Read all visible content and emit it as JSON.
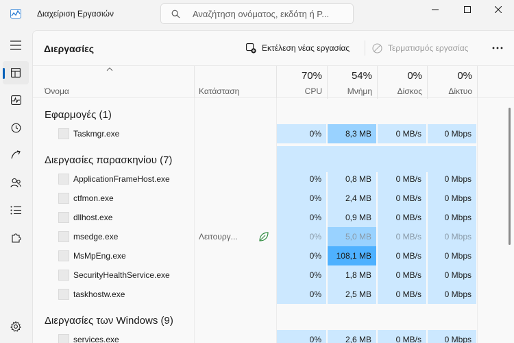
{
  "window": {
    "title": "Διαχείριση Εργασιών",
    "search_placeholder": "Αναζήτηση ονόματος, εκδότη ή P..."
  },
  "toolbar": {
    "page_title": "Διεργασίες",
    "run_new_task": "Εκτέλεση νέας εργασίας",
    "end_task": "Τερματισμός εργασίας"
  },
  "columns": {
    "name": "Όνομα",
    "status": "Κατάσταση",
    "cpu": {
      "percent": "70%",
      "label": "CPU"
    },
    "memory": {
      "percent": "54%",
      "label": "Μνήμη"
    },
    "disk": {
      "percent": "0%",
      "label": "Δίσκος"
    },
    "network": {
      "percent": "0%",
      "label": "Δίκτυο"
    }
  },
  "groups": {
    "apps": {
      "label": "Εφαρμογές (1)",
      "rows": [
        {
          "name": "Taskmgr.exe",
          "status": "",
          "cpu": "0%",
          "memory": "8,3 MB",
          "disk": "0 MB/s",
          "network": "0 Mbps"
        }
      ]
    },
    "background": {
      "label": "Διεργασίες παρασκηνίου (7)",
      "rows": [
        {
          "name": "ApplicationFrameHost.exe",
          "status": "",
          "cpu": "0%",
          "memory": "0,8 MB",
          "disk": "0 MB/s",
          "network": "0 Mbps"
        },
        {
          "name": "ctfmon.exe",
          "status": "",
          "cpu": "0%",
          "memory": "2,4 MB",
          "disk": "0 MB/s",
          "network": "0 Mbps"
        },
        {
          "name": "dllhost.exe",
          "status": "",
          "cpu": "0%",
          "memory": "0,9 MB",
          "disk": "0 MB/s",
          "network": "0 Mbps"
        },
        {
          "name": "msedge.exe",
          "status": "Λειτουργ...",
          "cpu": "0%",
          "memory": "5,0 MB",
          "disk": "0 MB/s",
          "network": "0 Mbps"
        },
        {
          "name": "MsMpEng.exe",
          "status": "",
          "cpu": "0%",
          "memory": "108,1 MB",
          "disk": "0 MB/s",
          "network": "0 Mbps"
        },
        {
          "name": "SecurityHealthService.exe",
          "status": "",
          "cpu": "0%",
          "memory": "1,8 MB",
          "disk": "0 MB/s",
          "network": "0 Mbps"
        },
        {
          "name": "taskhostw.exe",
          "status": "",
          "cpu": "0%",
          "memory": "2,5 MB",
          "disk": "0 MB/s",
          "network": "0 Mbps"
        }
      ]
    },
    "windows": {
      "label": "Διεργασίες των Windows (9)",
      "rows": [
        {
          "name": "services.exe",
          "status": "",
          "cpu": "0%",
          "memory": "2,6 MB",
          "disk": "0 MB/s",
          "network": "0 Mbps"
        }
      ]
    }
  },
  "colors": {
    "heat_low": "#cce8ff",
    "heat_mid": "#99d2ff",
    "heat_high": "#4eb1ff",
    "accent": "#005fb8"
  }
}
